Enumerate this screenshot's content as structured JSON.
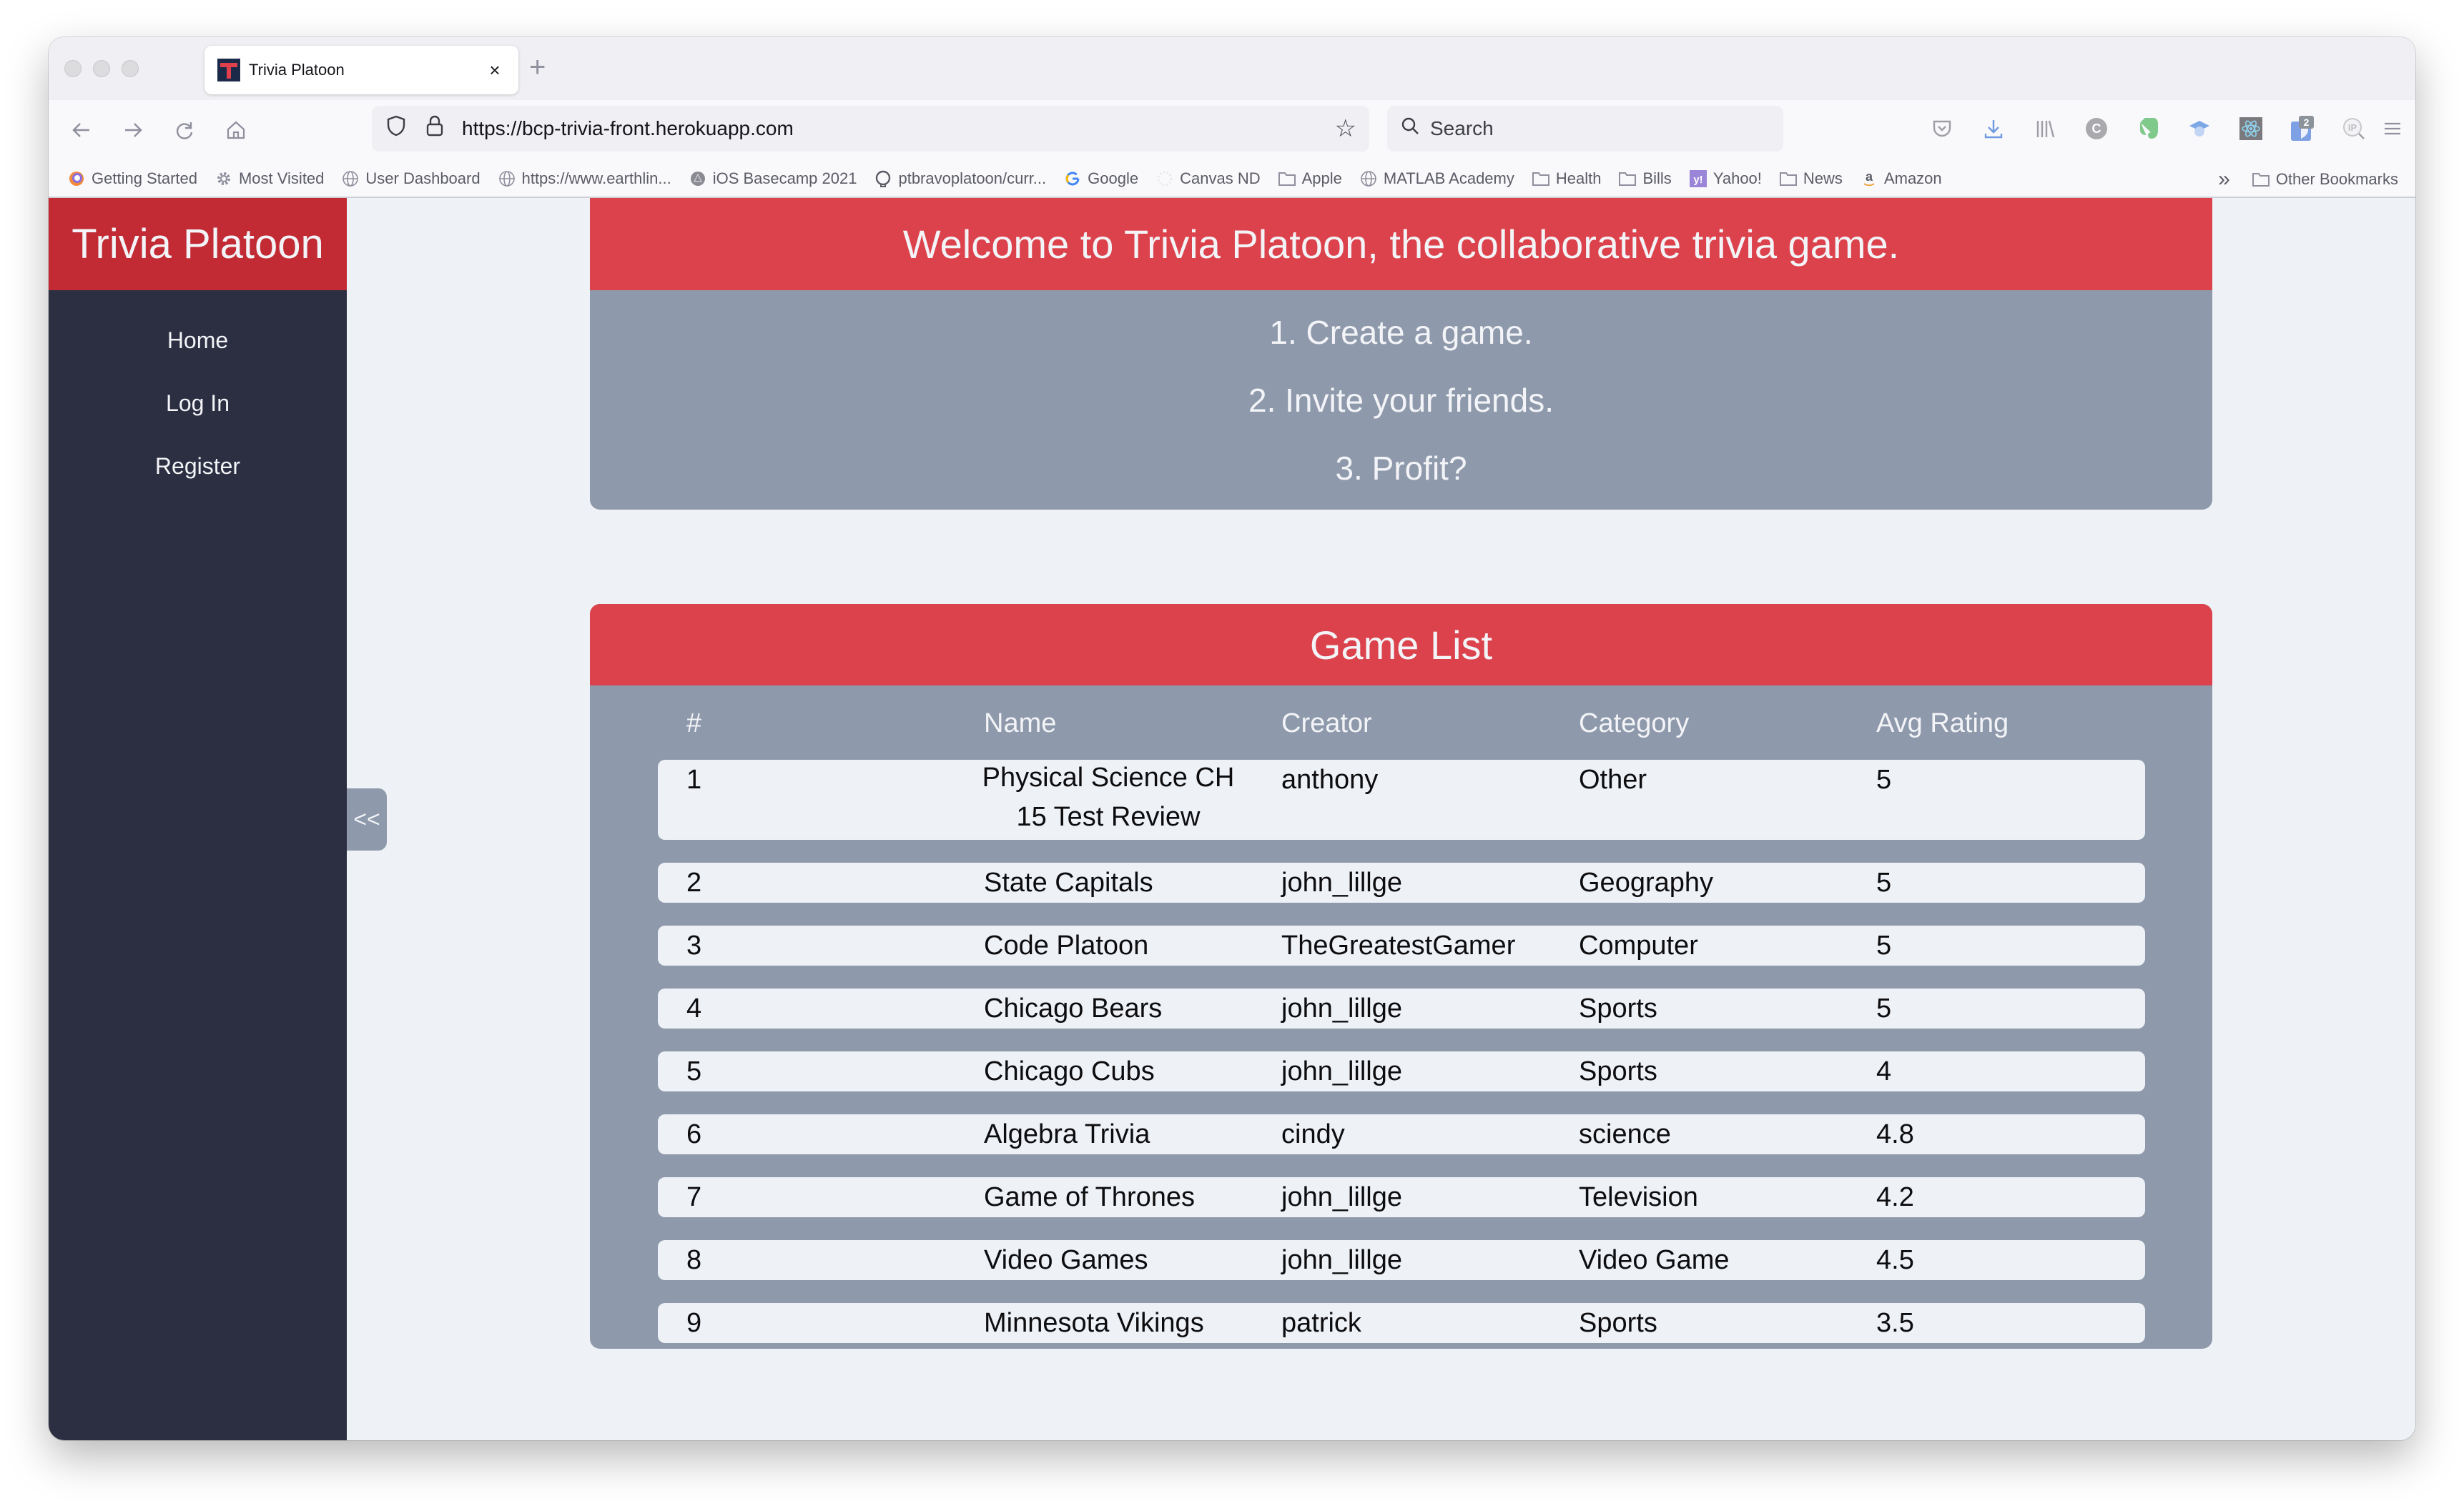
{
  "browser": {
    "tab_title": "Trivia Platoon",
    "tab_close": "×",
    "new_tab": "+",
    "url": "https://bcp-trivia-front.herokuapp.com",
    "search_placeholder": "Search",
    "extension_badge": "2",
    "bookmarks": [
      {
        "label": "Getting Started",
        "icon": "firefox-icon"
      },
      {
        "label": "Most Visited",
        "icon": "gear-icon"
      },
      {
        "label": "User Dashboard",
        "icon": "globe-icon"
      },
      {
        "label": "https://www.earthlin...",
        "icon": "globe-icon"
      },
      {
        "label": "iOS Basecamp 2021",
        "icon": "circle-icon"
      },
      {
        "label": "ptbravoplatoon/curr...",
        "icon": "github-icon"
      },
      {
        "label": "Google",
        "icon": "google-icon"
      },
      {
        "label": "Canvas ND",
        "icon": "canvas-icon"
      },
      {
        "label": "Apple",
        "icon": "folder-icon"
      },
      {
        "label": "MATLAB Academy",
        "icon": "globe-icon"
      },
      {
        "label": "Health",
        "icon": "folder-icon"
      },
      {
        "label": "Bills",
        "icon": "folder-icon"
      },
      {
        "label": "Yahoo!",
        "icon": "yahoo-icon"
      },
      {
        "label": "News",
        "icon": "folder-icon"
      },
      {
        "label": "Amazon",
        "icon": "amazon-icon"
      }
    ],
    "overflow": "»",
    "other_bookmarks": "Other Bookmarks"
  },
  "sidebar": {
    "brand": "Trivia Platoon",
    "items": [
      {
        "label": "Home"
      },
      {
        "label": "Log In"
      },
      {
        "label": "Register"
      }
    ],
    "collapse_label": "<<"
  },
  "welcome": {
    "title": "Welcome to Trivia Platoon, the collaborative trivia game.",
    "steps": [
      "1. Create a game.",
      "2. Invite your friends.",
      "3. Profit?"
    ]
  },
  "game_list": {
    "title": "Game List",
    "columns": [
      "#",
      "Name",
      "Creator",
      "Category",
      "Avg Rating"
    ],
    "rows": [
      {
        "num": "1",
        "name": "Physical Science CH 15 Test Review",
        "creator": "anthony",
        "category": "Other",
        "rating": "5"
      },
      {
        "num": "2",
        "name": "State Capitals",
        "creator": "john_lillge",
        "category": "Geography",
        "rating": "5"
      },
      {
        "num": "3",
        "name": "Code Platoon",
        "creator": "TheGreatestGamer",
        "category": "Computer",
        "rating": "5"
      },
      {
        "num": "4",
        "name": "Chicago Bears",
        "creator": "john_lillge",
        "category": "Sports",
        "rating": "5"
      },
      {
        "num": "5",
        "name": "Chicago Cubs",
        "creator": "john_lillge",
        "category": "Sports",
        "rating": "4"
      },
      {
        "num": "6",
        "name": "Algebra Trivia",
        "creator": "cindy",
        "category": "science",
        "rating": "4.8"
      },
      {
        "num": "7",
        "name": "Game of Thrones",
        "creator": "john_lillge",
        "category": "Television",
        "rating": "4.2"
      },
      {
        "num": "8",
        "name": "Video Games",
        "creator": "john_lillge",
        "category": "Video Game",
        "rating": "4.5"
      },
      {
        "num": "9",
        "name": "Minnesota Vikings",
        "creator": "patrick",
        "category": "Sports",
        "rating": "3.5"
      }
    ]
  },
  "colors": {
    "brand_red": "#c22a34",
    "header_red": "#dc424c",
    "sidebar_dark": "#2c2e42",
    "card_gray": "#8e99ab",
    "page_bg": "#eef1f5"
  }
}
